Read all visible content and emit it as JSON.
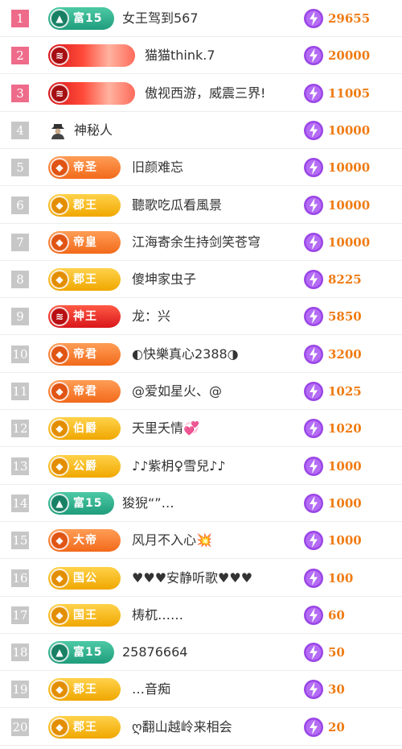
{
  "colors": {
    "rank_top": "#ee6b8a",
    "rank_default": "#c7c7c7",
    "points": "#ef7b13",
    "bolt": "#9a45e6"
  },
  "icons": {
    "points": "lightning-bolt-icon",
    "mystery": "hooded-figure-icon"
  },
  "rows": [
    {
      "rank": "1",
      "badge": "富15",
      "badge_style": "green",
      "name": "女王驾到567",
      "points": "29655"
    },
    {
      "rank": "2",
      "badge": "",
      "badge_style": "crimson",
      "name": "猫猫think.7",
      "points": "20000"
    },
    {
      "rank": "3",
      "badge": "",
      "badge_style": "crimson",
      "name": "傲视西游，威震三界!",
      "points": "11005"
    },
    {
      "rank": "4",
      "badge": "",
      "badge_style": "mystery",
      "name": "神秘人",
      "points": "10000"
    },
    {
      "rank": "5",
      "badge": "帝圣",
      "badge_style": "orange",
      "name": "旧颜难忘",
      "points": "10000"
    },
    {
      "rank": "6",
      "badge": "郡王",
      "badge_style": "gold",
      "name": "聽歌吃瓜看風景",
      "points": "10000"
    },
    {
      "rank": "7",
      "badge": "帝皇",
      "badge_style": "orange",
      "name": "江海寄余生持剑笑苍穹",
      "points": "10000"
    },
    {
      "rank": "8",
      "badge": "郡王",
      "badge_style": "gold",
      "name": "傻坤家虫子",
      "points": "8225"
    },
    {
      "rank": "9",
      "badge": "神王",
      "badge_style": "red",
      "name": "龙：兴",
      "points": "5850"
    },
    {
      "rank": "10",
      "badge": "帝君",
      "badge_style": "orange",
      "name": "◐快樂真心2388◑",
      "points": "3200"
    },
    {
      "rank": "11",
      "badge": "帝君",
      "badge_style": "orange",
      "name": "@爱如星火、@",
      "points": "1025"
    },
    {
      "rank": "12",
      "badge": "伯爵",
      "badge_style": "gold",
      "name": "天里夭情💞",
      "points": "1020"
    },
    {
      "rank": "13",
      "badge": "公爵",
      "badge_style": "gold",
      "name": "♪♪紫枂♀雪兒♪♪",
      "points": "1000"
    },
    {
      "rank": "14",
      "badge": "富15",
      "badge_style": "green",
      "name": "狻猊“”…",
      "points": "1000"
    },
    {
      "rank": "15",
      "badge": "大帝",
      "badge_style": "orange",
      "name": "风月不入心💥",
      "points": "1000"
    },
    {
      "rank": "16",
      "badge": "国公",
      "badge_style": "gold",
      "name": "♥♥♥安静听歌♥♥♥",
      "points": "100"
    },
    {
      "rank": "17",
      "badge": "国王",
      "badge_style": "gold",
      "name": "梼杌……",
      "points": "60"
    },
    {
      "rank": "18",
      "badge": "富15",
      "badge_style": "green",
      "name": "25876664",
      "points": "50"
    },
    {
      "rank": "19",
      "badge": "郡王",
      "badge_style": "gold",
      "name": "…音痴",
      "points": "30"
    },
    {
      "rank": "20",
      "badge": "郡王",
      "badge_style": "gold",
      "name": "ღ翻山越岭来相会",
      "points": "20"
    }
  ]
}
